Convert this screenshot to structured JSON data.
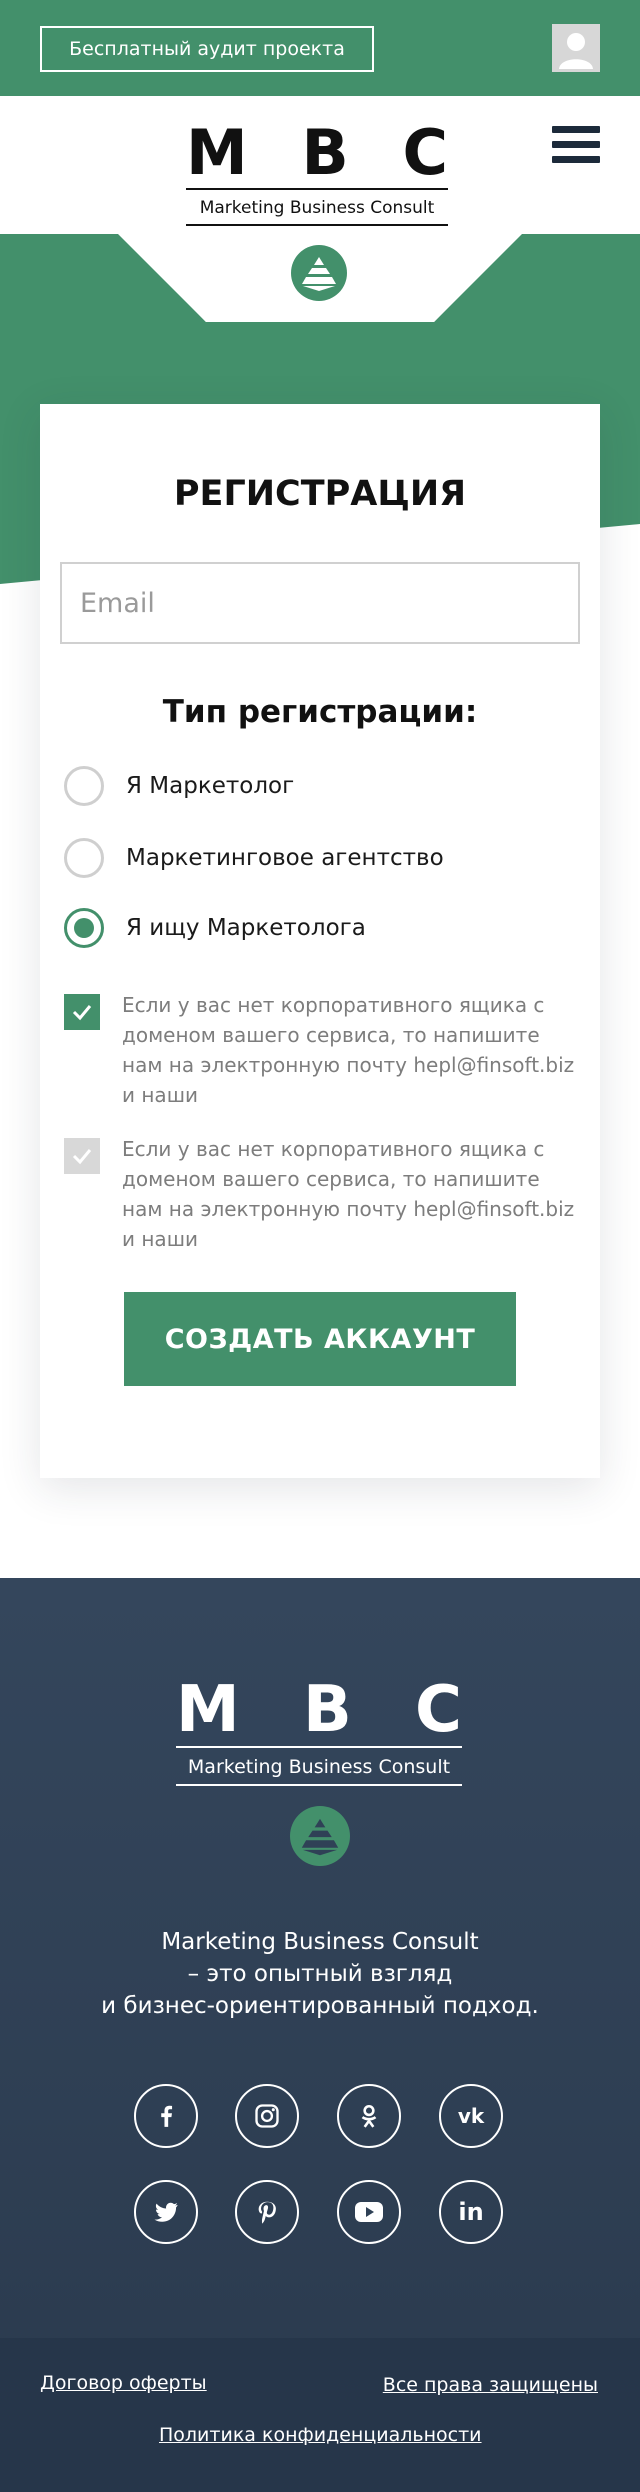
{
  "topbar": {
    "audit_label": "Бесплатный аудит проекта",
    "user_icon": "user-avatar-icon"
  },
  "brand": {
    "letters": [
      "M",
      "B",
      "C"
    ],
    "subtitle": "Marketing Business Consult",
    "badge_icon": "pyramid-icon"
  },
  "menu": {
    "icon": "hamburger-menu-icon"
  },
  "registration": {
    "title": "РЕГИСТРАЦИЯ",
    "email_placeholder": "Email",
    "type_heading": "Тип регистрации:",
    "options": [
      {
        "label": "Я Маркетолог",
        "selected": false
      },
      {
        "label": "Маркетинговое агентство",
        "selected": false
      },
      {
        "label": "Я ищу Маркетолога",
        "selected": true
      }
    ],
    "checkboxes": [
      {
        "text": "Если у вас нет корпоративного ящика с доменом вашего сервиса, то напишите нам на электронную почту hepl@finsoft.biz и наши",
        "checked": true
      },
      {
        "text": "Если у вас нет корпоративного ящика с доменом вашего сервиса, то напишите нам на электронную почту hepl@finsoft.biz и наши",
        "checked": false
      }
    ],
    "submit_label": "СОЗДАТЬ АККАУНТ"
  },
  "footer": {
    "description": [
      "Marketing Business Consult",
      "– это опытный взгляд",
      "и бизнес-ориентированный подход."
    ],
    "social": [
      "facebook-icon",
      "instagram-icon",
      "odnoklassniki-icon",
      "vk-icon",
      "twitter-icon",
      "pinterest-icon",
      "youtube-icon",
      "linkedin-icon"
    ],
    "links": {
      "offer": "Договор оферты",
      "rights": "Все права защищены",
      "privacy": "Политика конфиденциальности"
    }
  },
  "colors": {
    "accent": "#43906b",
    "dark": "#2f4156",
    "bottom_bar": "#26364a"
  }
}
